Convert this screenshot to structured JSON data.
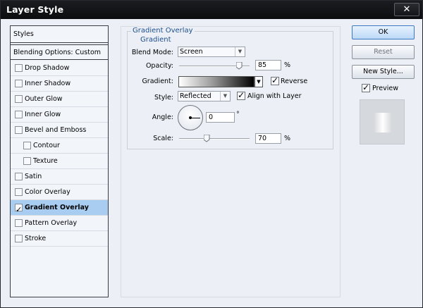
{
  "window": {
    "title": "Layer Style",
    "close_glyph": "✕"
  },
  "styles": {
    "header": "Styles",
    "blending_options": "Blending Options: Custom",
    "items": [
      {
        "label": "Drop Shadow",
        "checked": false,
        "indent": false
      },
      {
        "label": "Inner Shadow",
        "checked": false,
        "indent": false
      },
      {
        "label": "Outer Glow",
        "checked": false,
        "indent": false
      },
      {
        "label": "Inner Glow",
        "checked": false,
        "indent": false
      },
      {
        "label": "Bevel and Emboss",
        "checked": false,
        "indent": false
      },
      {
        "label": "Contour",
        "checked": false,
        "indent": true
      },
      {
        "label": "Texture",
        "checked": false,
        "indent": true
      },
      {
        "label": "Satin",
        "checked": false,
        "indent": false
      },
      {
        "label": "Color Overlay",
        "checked": false,
        "indent": false
      },
      {
        "label": "Gradient Overlay",
        "checked": true,
        "indent": false,
        "selected": true
      },
      {
        "label": "Pattern Overlay",
        "checked": false,
        "indent": false
      },
      {
        "label": "Stroke",
        "checked": false,
        "indent": false
      }
    ]
  },
  "panel": {
    "group_title": "Gradient Overlay",
    "group_subtitle": "Gradient",
    "blend_mode": {
      "label": "Blend Mode:",
      "value": "Screen"
    },
    "opacity": {
      "label": "Opacity:",
      "value": "85",
      "unit": "%",
      "level": 85
    },
    "gradient": {
      "label": "Gradient:",
      "reverse_label": "Reverse",
      "reverse_checked": true,
      "colors": [
        "#ffffff",
        "#000000"
      ]
    },
    "style": {
      "label": "Style:",
      "value": "Reflected",
      "align_label": "Align with Layer",
      "align_checked": true
    },
    "angle": {
      "label": "Angle:",
      "value": "0",
      "unit": "°"
    },
    "scale": {
      "label": "Scale:",
      "value": "70",
      "unit": "%",
      "level": 70
    }
  },
  "buttons": {
    "ok": "OK",
    "reset": "Reset",
    "new_style": "New Style...",
    "preview_label": "Preview",
    "preview_checked": true
  },
  "icons": {
    "dropdown": "chevron-down-icon",
    "close": "close-icon"
  }
}
